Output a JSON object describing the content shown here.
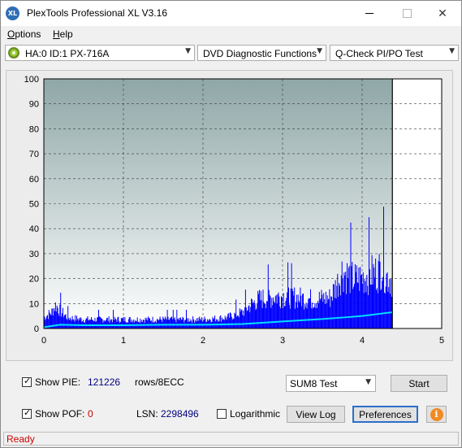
{
  "window": {
    "icon_text": "XL",
    "title": "PlexTools Professional XL V3.16",
    "minimize_glyph": "",
    "maximize_glyph": "",
    "close_glyph": "✕"
  },
  "menu": {
    "options": {
      "accel": "O",
      "rest": "ptions"
    },
    "help": {
      "accel": "H",
      "rest": "elp"
    }
  },
  "toolbar": {
    "drive": "HA:0 ID:1  PX-716A",
    "function": "DVD Diagnostic Functions",
    "test": "Q-Check PI/PO Test",
    "arrow_glyph": "▼"
  },
  "chart_data": {
    "type": "area",
    "x_ticks": [
      "0",
      "1",
      "2",
      "3",
      "4",
      "5"
    ],
    "y_ticks": [
      "0",
      "10",
      "20",
      "30",
      "40",
      "50",
      "60",
      "70",
      "80",
      "90",
      "100"
    ],
    "xlim": [
      0,
      5
    ],
    "ylim": [
      0,
      100
    ],
    "grid": true,
    "scan_end_x": 4.38,
    "background_top": "#8fa7a7",
    "background_bottom": "#ffffff",
    "series": [
      {
        "kind": "pie_bars",
        "color": "#0000ff",
        "x": [
          0.0,
          0.1,
          0.15,
          0.2,
          0.3,
          0.5,
          0.8,
          1.0,
          1.5,
          2.0,
          2.3,
          2.5,
          2.6,
          2.7,
          2.8,
          3.0,
          3.2,
          3.4,
          3.6,
          3.7,
          3.75,
          3.8,
          3.9,
          4.0,
          4.1,
          4.2,
          4.25,
          4.3,
          4.38
        ],
        "y": [
          6,
          9,
          13,
          10,
          6,
          5,
          5,
          5,
          5,
          5,
          6,
          9,
          13,
          16,
          17,
          18,
          17,
          16,
          17,
          26,
          32,
          30,
          27,
          28,
          30,
          31,
          35,
          29,
          27
        ]
      },
      {
        "kind": "pie_average",
        "color": "#00e0ff",
        "x": [
          0.0,
          0.2,
          0.5,
          1.0,
          1.5,
          2.0,
          2.5,
          3.0,
          3.5,
          3.8,
          4.0,
          4.2,
          4.38
        ],
        "y": [
          0.5,
          1.5,
          1.3,
          1.3,
          1.5,
          1.5,
          1.8,
          2.8,
          3.8,
          4.5,
          5.0,
          5.8,
          6.5
        ]
      }
    ]
  },
  "controls": {
    "show_pie_label": "Show PIE:",
    "show_pie_checked": true,
    "pie_value": "121226",
    "pie_units": "rows/8ECC",
    "show_pof_label": "Show POF:",
    "show_pof_checked": true,
    "pof_value": "0",
    "lsn_label": "LSN:",
    "lsn_value": "2298496",
    "logarithmic_label": "Logarithmic",
    "logarithmic_checked": false,
    "test_select": "SUM8 Test",
    "start_button": "Start",
    "view_log_button": "View Log",
    "preferences_button": "Preferences",
    "info_glyph": "i",
    "check_glyph": "✓"
  },
  "status": {
    "text": "Ready"
  }
}
